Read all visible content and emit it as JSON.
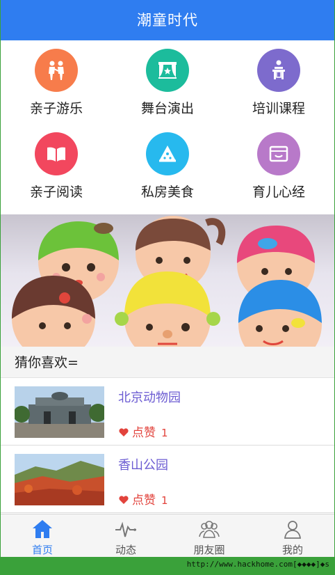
{
  "header": {
    "title": "潮童时代"
  },
  "categories": [
    {
      "label": "亲子游乐",
      "icon": "family-icon",
      "color": "#f77c4b"
    },
    {
      "label": "舞台演出",
      "icon": "stage-icon",
      "color": "#1cbc9c"
    },
    {
      "label": "培训课程",
      "icon": "teacher-icon",
      "color": "#7d6bcd"
    },
    {
      "label": "亲子阅读",
      "icon": "book-icon",
      "color": "#f2475e"
    },
    {
      "label": "私房美食",
      "icon": "pizza-icon",
      "color": "#27b9ee"
    },
    {
      "label": "育儿心经",
      "icon": "inbox-icon",
      "color": "#b879c9"
    }
  ],
  "section": {
    "title": "猜你喜欢="
  },
  "items": [
    {
      "title": "北京动物园",
      "like_label": "点赞",
      "likes": "1"
    },
    {
      "title": "香山公园",
      "like_label": "点赞",
      "likes": "1"
    }
  ],
  "tabs": [
    {
      "label": "首页",
      "icon": "home-icon",
      "active": true
    },
    {
      "label": "动态",
      "icon": "pulse-icon",
      "active": false
    },
    {
      "label": "朋友圈",
      "icon": "friends-icon",
      "active": false
    },
    {
      "label": "我的",
      "icon": "user-icon",
      "active": false
    }
  ],
  "watermark": "http://www.hackhome.com[◆◆◆◆]◆s",
  "colors": {
    "primary": "#2f7df0",
    "like": "#e2433c",
    "item_title": "#6b5bd2"
  }
}
